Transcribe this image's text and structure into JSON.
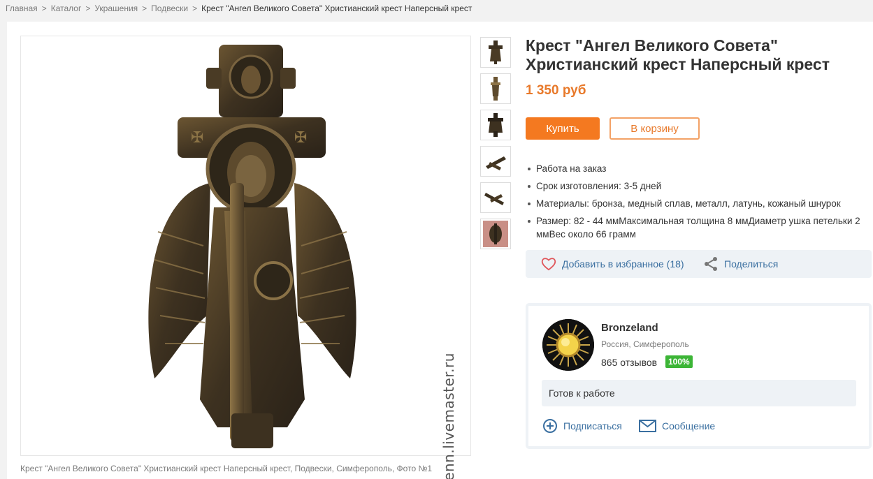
{
  "breadcrumb": {
    "items": [
      "Главная",
      "Каталог",
      "Украшения",
      "Подвески"
    ],
    "separator": ">",
    "current": "Крест \"Ангел Великого Совета\" Христианский крест Наперсный крест"
  },
  "product": {
    "title": "Крест \"Ангел Великого Совета\" Христианский крест Наперсный крест",
    "price": "1 350 руб",
    "buy_label": "Купить",
    "cart_label": "В корзину",
    "features": [
      "Работа на заказ",
      "Срок изготовления: 3-5 дней",
      "Материалы:  бронза, медный сплав, металл, латунь, кожаный шнурок",
      "Размер:  82 - 44 ммМаксимальная толщина 8 ммДиаметр ушка петельки 2 ммВес около 66 грамм"
    ],
    "favorite_label": "Добавить в избранное (18)",
    "share_label": "Поделиться",
    "watermark": "benn.livemaster.ru",
    "caption": "Крест \"Ангел Великого Совета\" Христианский крест Наперсный крест, Подвески, Симферополь, Фото №1",
    "thumbnail_count": 6
  },
  "seller": {
    "name": "Bronzeland",
    "location": "Россия, Симферополь",
    "reviews": "865 отзывов",
    "rating_badge": "100%",
    "status": "Готов к работе",
    "subscribe_label": "Подписаться",
    "message_label": "Сообщение"
  },
  "colors": {
    "accent": "#f47920",
    "price": "#e8792a",
    "link": "#3a6fa0",
    "badge": "#3cb536"
  }
}
